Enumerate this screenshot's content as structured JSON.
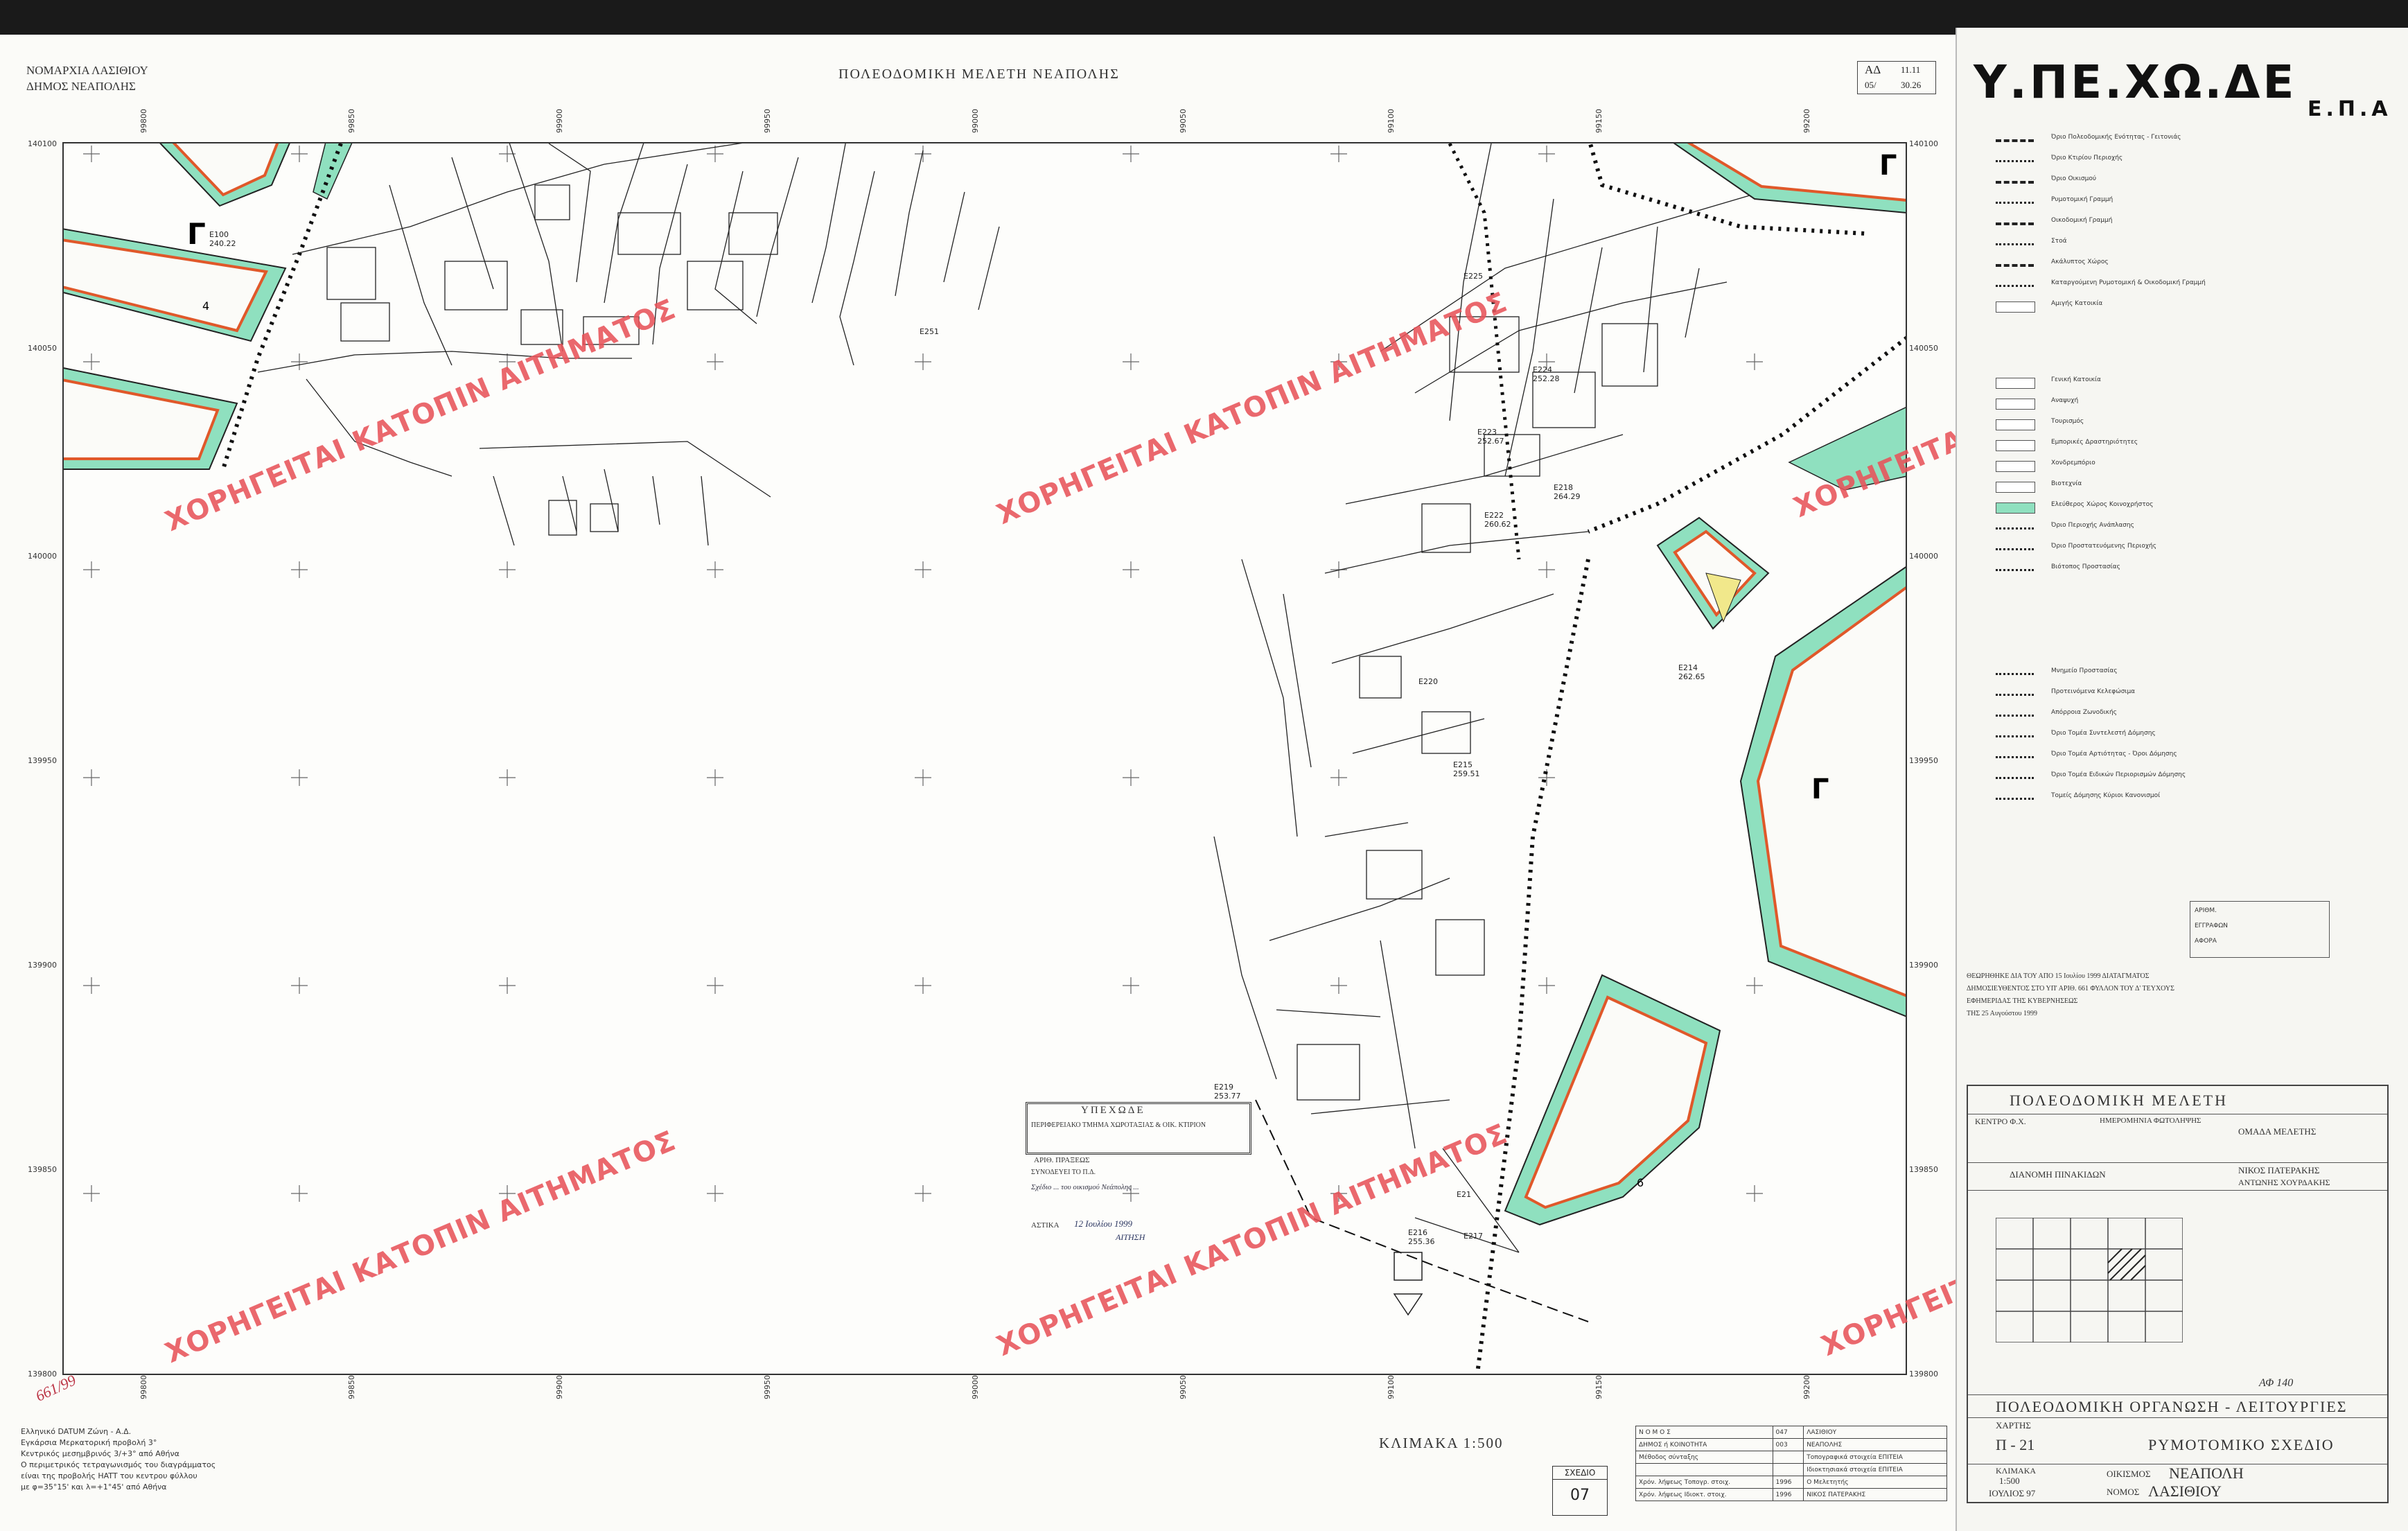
{
  "header": {
    "prefecture": "ΝΟΜΑΡΧΙΑ ΛΑΣΙΘΙΟΥ",
    "municipality": "ΔΗΜΟΣ    ΝΕΑΠΟΛΗΣ",
    "title": "ΠΟΛΕΟΔΟΜΙΚΗ ΜΕΛΕΤΗ ΝΕΑΠΟΛΗΣ",
    "sheet_code": "ΑΔ",
    "sheet_a": "11.11",
    "sheet_b": "05/",
    "sheet_c": "30.26"
  },
  "grid": {
    "x_labels": [
      "99800",
      "99850",
      "99900",
      "99950",
      "99000",
      "99050",
      "99100",
      "99150",
      "99200"
    ],
    "y_labels": [
      "140100",
      "140050",
      "140000",
      "139950",
      "139900",
      "139850",
      "139800"
    ]
  },
  "blocks": {
    "gamma_1": "Γ",
    "gamma_2": "Γ",
    "gamma_3": "Γ",
    "side_4": "4",
    "side_6": "6"
  },
  "points": [
    {
      "label": "Ε100",
      "sub": "240.22"
    },
    {
      "label": "Ε251",
      "sub": ""
    },
    {
      "label": "Ε225",
      "sub": ""
    },
    {
      "label": "Ε224",
      "sub": "252.28"
    },
    {
      "label": "Ε223",
      "sub": "252.67"
    },
    {
      "label": "Ε222",
      "sub": "260.62"
    },
    {
      "label": "Ε220",
      "sub": ""
    },
    {
      "label": "Ε215",
      "sub": "259.51"
    },
    {
      "label": "Ε214",
      "sub": "262.65"
    },
    {
      "label": "Ε218",
      "sub": "264.29"
    },
    {
      "label": "Ε219",
      "sub": "253.77"
    },
    {
      "label": "Ε21",
      "sub": ""
    },
    {
      "label": "Ε216",
      "sub": "255.36"
    },
    {
      "label": "Ε217",
      "sub": ""
    }
  ],
  "watermark": {
    "text": "ΧΟΡΗΓΕΙΤΑΙ ΚΑΤΟΠΙΝ ΑΙΤΗΜΑΤΟΣ"
  },
  "stamp": {
    "line1": "ΥΠΕΧΩΔΕ",
    "line2": "ΠΕΡΙΦΕΡΕΙΑΚΟ ΤΜΗΜΑ ΧΩΡΟΤΑΞΙΑΣ & ΟΙΚ. ΚΤΙΡΙΟΝ",
    "line3": "ΑΡΙΘ. ΠΡΑΞΕΩΣ",
    "line4": "ΣΥΝΟΔΕΥΕΙ ΤΟ Π.Δ.",
    "date_label": "ΑΣΤΙΚΑ",
    "date_value": "12 Ιουλίου 1999",
    "signature": "ΑΙΤΗΣΗ"
  },
  "footer": {
    "scale": "ΚΛΙΜΑΚΑ 1:500",
    "notes": [
      "Ελληνικό DATUM   Ζώνη - Α.Δ.",
      "Εγκάρσια Μερκατορική προβολή 3°",
      "Κεντρικός μεσημβρινός 3/+3° από Αθήνα",
      "Ο περιμετρικός τετραγωνισμός του διαγράμματος",
      "είναι της προβολής HATT του κεντρου φύλλου",
      "με φ=35°15'  και  λ=+1°45'  από Αθήνα"
    ],
    "plan_label": "ΣΧΕΔΙΟ",
    "plan_no": "07",
    "handwritten_code": "661/99"
  },
  "info_table": [
    {
      "k": "Ν Ο Μ Ο Σ",
      "code": "047",
      "v": "ΛΑΣΙΘΙΟΥ"
    },
    {
      "k": "ΔΗΜΟΣ ή ΚΟΙΝΟΤΗΤΑ",
      "code": "003",
      "v": "ΝΕΑΠΟΛΗΣ"
    },
    {
      "k": "Μέθοδος σύνταξης",
      "code": "",
      "v": "Τοπογραφικά στοιχεία   ΕΠΙΤΕΙΑ"
    },
    {
      "k": "",
      "code": "",
      "v": "Ιδιοκτησιακά στοιχεία   ΕΠΙΤΕΙΑ"
    },
    {
      "k": "Χρόν. λήψεως Τοπογρ. στοιχ.",
      "code": "1996",
      "v": "Ο Μελετητής"
    },
    {
      "k": "Χρόν. λήψεως Ιδιοκτ. στοιχ.",
      "code": "1996",
      "v": "ΝΙΚΟΣ ΠΑΤΕΡΑΚΗΣ"
    }
  ],
  "legend": {
    "logo": "Υ.ΠΕ.ΧΩ.ΔΕ",
    "logo_sub": "Ε.Π.Α",
    "items": [
      "Όριο Πολεοδομικής Ενότητας - Γειτονιάς",
      "Όριο Κτιρίου Περιοχής",
      "Όριο Οικισμού",
      "Ρυμοτομική Γραμμή",
      "Οικοδομική Γραμμή",
      "Στοά",
      "Ακάλυπτος Χώρος",
      "Καταργούμενη Ρυμοτομική & Οικοδομική Γραμμή",
      "Αμιγής Κατοικία",
      "Γενική Κατοικία",
      "Αναψυχή",
      "Τουρισμός",
      "Εμπορικές Δραστηριότητες",
      "Χονδρεμπόριο",
      "Βιοτεχνία",
      "Ελεύθερος Χώρος Κοινοχρήστος",
      "Όριο Περιοχής Ανάπλασης",
      "Όριο Προστατευόμενης Περιοχής",
      "Βιότοπος Προστασίας",
      "Μνημείο Προστασίας",
      "Προτεινόμενα Κελεφώσιμα",
      "Απόρροια Ζωνοδικής",
      "Όριο Τομέα Συντελεστή Δόμησης",
      "Όριο Τομέα Αρτιότητας - Όροι Δόμησης",
      "Όριο Τομέα Ειδικών Περιορισμών Δόμησης",
      "Τομείς Δόμησης Κύριοι Κανονισμοί"
    ]
  },
  "approval": {
    "line1": "ΘΕΩΡΗΘΗΚΕ ΔΙΑ ΤΟΥ ΑΠΟ   15 Ιουλίου 1999   ΔΙΑΤΑΓΜΑΤΟΣ",
    "line2": "ΔΗΜΟΣΙΕΥΘΕΝΤΟΣ ΣΤΟ ΥΠ' ΑΡΙΘ.  661   ΦΥΛΛΟΝ ΤΟΥ Δ' ΤΕΥΧΟΥΣ",
    "line3": "ΕΦΗΜΕΡΙΔΑΣ ΤΗΣ ΚΥΒΕΡΝΗΣΕΩΣ",
    "line4": "ΤΗΣ   25 Αυγούστου 1999",
    "side1": "ΑΡΙΘΜ.",
    "side2": "ΕΓΓΡΑΦΩΝ",
    "side3": "ΑΦΟΡΑ"
  },
  "titleblock": {
    "heading": "ΠΟΛΕΟΔΟΜΙΚΗ ΜΕΛΕΤΗ",
    "center": "ΚΕΝΤΡΟ Φ.Χ.",
    "date": "ΗΜΕΡΟΜΗΝΙΑ ΦΩΤΟΛΗΨΗΣ",
    "study": "ΟΜΑΔΑ ΜΕΛΕΤΗΣ",
    "distribution": "ΔΙΑΝΟΜΗ ΠΙΝΑΚΙΔΩΝ",
    "team1": "ΝΙΚΟΣ ΠΑΤΕΡΑΚΗΣ",
    "team2": "ΑΝΤΩΝΗΣ ΧΟΥΡΔΑΚΗΣ",
    "sheetref": "ΑΦ 140",
    "org": "ΠΟΛΕΟΔΟΜΙΚΗ ΟΡΓΑΝΩΣΗ - ΛΕΙΤΟΥΡΓΙΕΣ",
    "map_label": "ΧΑΡΤΗΣ",
    "map_no": "Π - 21",
    "plan": "ΡΥΜΟΤΟΜΙΚΟ ΣΧΕΔΙΟ",
    "scale_label": "ΚΛΙΜΑΚΑ",
    "scale": "1:500",
    "date2": "ΙΟΥΛΙΟΣ  97",
    "town_label": "ΟΙΚΙΣΜΟΣ",
    "town": "ΝΕΑΠΟΛΗ",
    "nomos_label": "ΝΟΜΟΣ",
    "nomos": "ΛΑΣΙΘΙΟΥ"
  },
  "colors": {
    "green": "#6fd3a9",
    "orange": "#e0582a",
    "watermark": "#e8545a"
  }
}
